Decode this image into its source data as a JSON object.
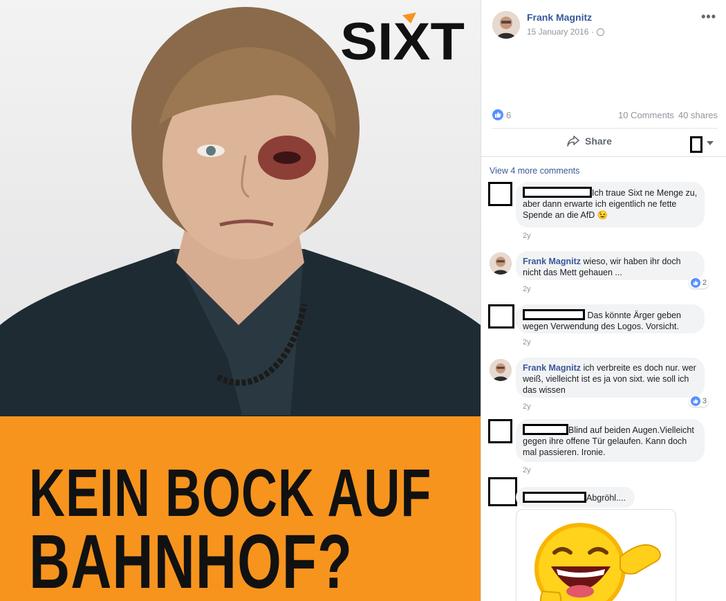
{
  "image_panel": {
    "logo_text": "SiXT",
    "headline_line1": "KEIN BOCK AUF",
    "headline_line2": "BAHNHOF?",
    "banner_color": "#f7941d"
  },
  "post": {
    "author": "Frank Magnitz",
    "date": "15 January 2016",
    "date_sep": "·",
    "privacy_icon": "globe-icon",
    "more_icon": "ellipsis-icon",
    "likes": "6",
    "comments_count": "10 Comments",
    "shares_count": "40 shares",
    "share_label": "Share"
  },
  "comments_section": {
    "view_more": "View 4 more comments",
    "comments": [
      {
        "author": "",
        "text": "Ich traue Sixt ne Menge zu, aber dann erwarte ich eigentlich ne fette Spende an die AfD",
        "emoji": "😉",
        "time": "2y"
      },
      {
        "author": "Frank Magnitz",
        "text": "wieso, wir haben ihr doch nicht das Mett gehauen ...",
        "time": "2y",
        "likes": "2"
      },
      {
        "author": "",
        "text": "Das könnte Ärger geben wegen Verwendung des Logos. Vorsicht.",
        "time": "2y"
      },
      {
        "author": "Frank Magnitz",
        "text": "ich verbreite es doch nur. wer weiß, vielleicht ist es ja von sixt. wie soll ich das wissen",
        "time": "2y",
        "likes": "3"
      },
      {
        "author": "",
        "text": "Blind auf beiden Augen.Vielleicht gegen ihre offene Tür gelaufen. Kann doch mal passieren. Ironie.",
        "time": "2y"
      },
      {
        "author": "",
        "text": "Abgröhl....",
        "attachment": "laughing-emoji-image"
      }
    ]
  },
  "colors": {
    "link_blue": "#385898",
    "like_blue": "#5890ff",
    "meta_gray": "#90949c"
  }
}
